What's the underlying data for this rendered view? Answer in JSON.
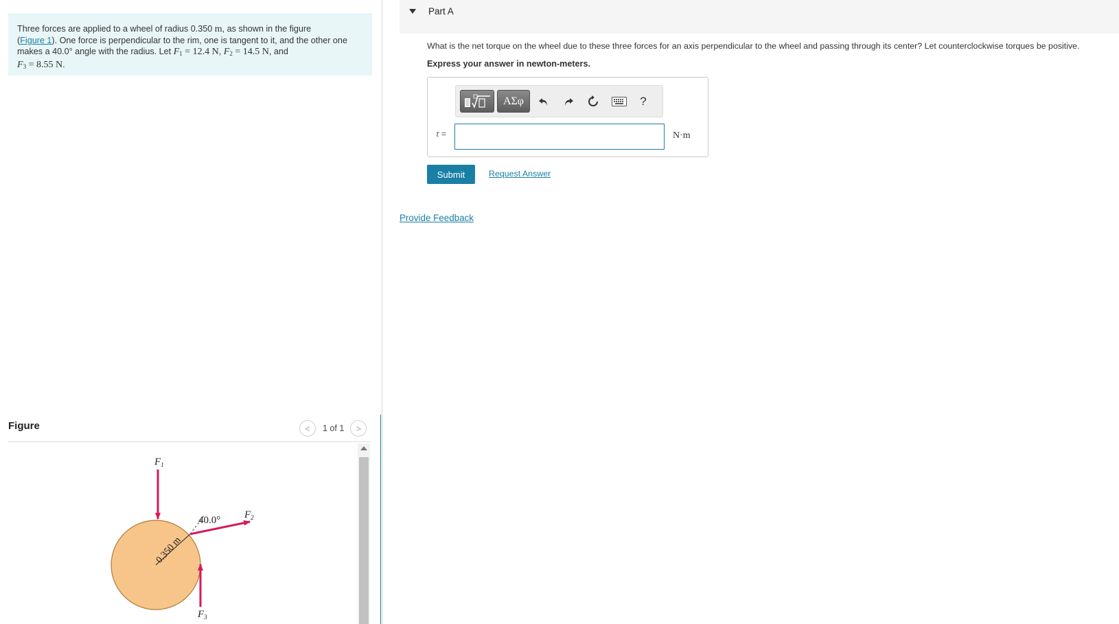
{
  "problem": {
    "text_1": "Three forces are applied to a wheel of radius 0.350 ",
    "unit_m": "m",
    "text_2": ", as shown in the figure",
    "paren_open": "(",
    "figure_link": "Figure 1",
    "text_3": "). One force is perpendicular to the rim, one is tangent to it, and the other one",
    "text_4": "makes a 40.0° angle with the radius. Let ",
    "f1_symbol": "F",
    "f1_sub": "1",
    "f1_value": " = 12.4 N",
    "comma_1": ", ",
    "f2_symbol": "F",
    "f2_sub": "2",
    "f2_value": " = 14.5 N",
    "and_text": ", and",
    "f3_symbol": "F",
    "f3_sub": "3",
    "f3_value": " = 8.55 N",
    "period": "."
  },
  "figure": {
    "heading": "Figure",
    "counter": "1 of 1",
    "prev_glyph": "<",
    "next_glyph": ">",
    "label_f1": "F",
    "label_f1_sub": "1",
    "label_f2": "F",
    "label_f2_sub": "2",
    "label_f3": "F",
    "label_f3_sub": "3",
    "angle_label": "40.0°",
    "radius_label": "0.350 m",
    "colors": {
      "wheel_fill": "#f7c48a",
      "wheel_stroke": "#b07a3a",
      "arrow": "#d6195b"
    }
  },
  "part": {
    "title": "Part A",
    "question": "What is the net torque on the wheel due to these three forces for an axis perpendicular to the wheel and passing through its center? Let counterclockwise torques be positive.",
    "instruction": "Express your answer in newton-meters.",
    "toolbar": {
      "templates_icon": "template-icon",
      "symbols_label": "ΑΣφ",
      "undo_icon": "undo-icon",
      "redo_icon": "redo-icon",
      "reset_icon": "reset-icon",
      "keyboard_icon": "keyboard-icon",
      "help_label": "?"
    },
    "answer_var": "τ",
    "answer_eq": " =",
    "answer_value": "",
    "units": "N·m",
    "submit_label": "Submit",
    "request_label": "Request Answer"
  },
  "feedback_label": "Provide Feedback",
  "colors": {
    "accent": "#1a7fa5",
    "problem_bg": "#e8f6f7"
  }
}
